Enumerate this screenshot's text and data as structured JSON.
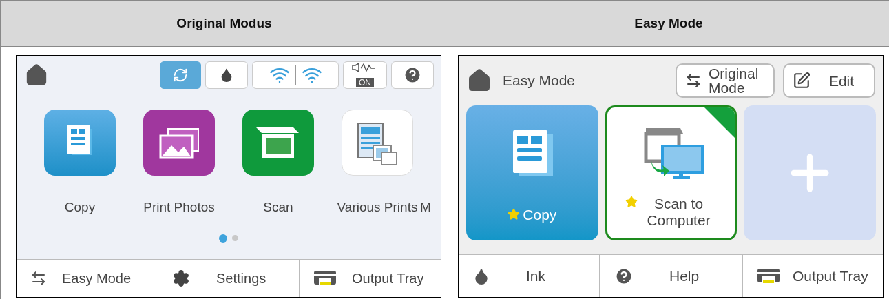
{
  "columns": [
    {
      "heading": "Original Modus"
    },
    {
      "heading": "Easy Mode"
    }
  ],
  "original_screen": {
    "status_icons": [
      {
        "kind": "sync",
        "selected": true
      },
      {
        "kind": "ink",
        "selected": false
      },
      {
        "kind": "wifi",
        "selected": false
      },
      {
        "kind": "sound",
        "label": "ON",
        "selected": false
      },
      {
        "kind": "help",
        "selected": false
      }
    ],
    "apps": [
      {
        "kind": "copy",
        "label": "Copy"
      },
      {
        "kind": "photos",
        "label": "Print Photos"
      },
      {
        "kind": "scan",
        "label": "Scan"
      },
      {
        "kind": "various",
        "label": "Various Prints"
      },
      {
        "kind": "cut",
        "label": "M"
      }
    ],
    "page_dots": [
      {
        "selected": true
      },
      {
        "selected": false
      }
    ],
    "bottom_bar": [
      {
        "kind": "swap",
        "label": "Easy Mode"
      },
      {
        "kind": "settings",
        "label": "Settings"
      },
      {
        "kind": "tray",
        "label": "Output Tray"
      }
    ]
  },
  "easy_screen": {
    "title": "Easy Mode",
    "buttons": [
      {
        "kind": "swap",
        "label": "Original Mode"
      },
      {
        "kind": "edit",
        "label": "Edit"
      }
    ],
    "tiles": [
      {
        "kind": "copy",
        "label": "Copy",
        "favorite": true,
        "selected": false
      },
      {
        "kind": "scan",
        "label": "Scan to Computer",
        "favorite": true,
        "selected": true
      },
      {
        "kind": "add",
        "selected": false
      }
    ],
    "bottom_bar": [
      {
        "kind": "ink",
        "label": "Ink"
      },
      {
        "kind": "help",
        "label": "Help"
      },
      {
        "kind": "tray",
        "label": "Output Tray"
      }
    ]
  }
}
